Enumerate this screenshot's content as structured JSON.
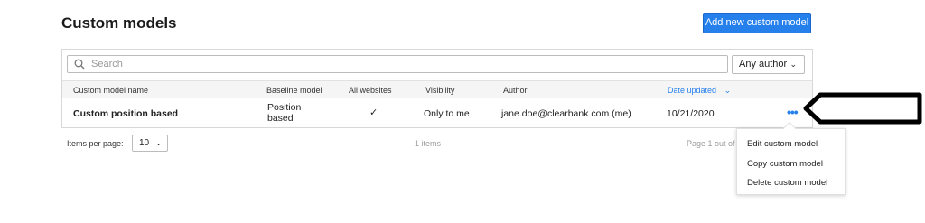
{
  "page": {
    "title": "Custom models",
    "add_button_label": "Add new custom model"
  },
  "search": {
    "placeholder": "Search",
    "value": ""
  },
  "author_filter": {
    "selected": "Any author"
  },
  "table": {
    "headers": {
      "name": "Custom model name",
      "baseline": "Baseline model",
      "all_websites": "All websites",
      "visibility": "Visibility",
      "author": "Author",
      "date_updated": "Date updated"
    },
    "sort_indicator": "⌄",
    "rows": [
      {
        "name": "Custom position based",
        "baseline": "Position based",
        "all_websites": "✓",
        "visibility": "Only to me",
        "author": "jane.doe@clearbank.com  (me)",
        "date_updated": "10/21/2020",
        "actions_icon": "•••"
      }
    ]
  },
  "pagination": {
    "items_per_page_label": "Items per page:",
    "items_per_page_value": "10",
    "items_count": "1 items",
    "page_info": "Page 1 out of"
  },
  "context_menu": {
    "items": [
      "Edit custom model",
      "Copy custom model",
      "Delete custom model"
    ]
  },
  "colors": {
    "accent": "#2680eb"
  }
}
